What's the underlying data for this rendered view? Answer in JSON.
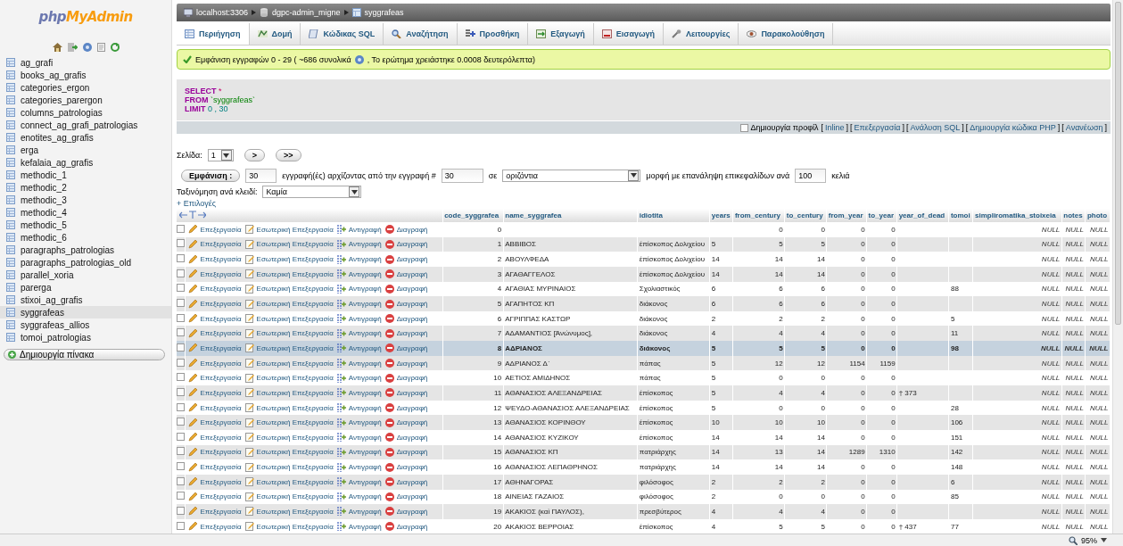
{
  "sidebar": {
    "logo": {
      "first": "php",
      "second": "MyAdmin"
    },
    "tables": [
      {
        "label": "ag_grafi",
        "selected": false
      },
      {
        "label": "books_ag_grafis",
        "selected": false
      },
      {
        "label": "categories_ergon",
        "selected": false
      },
      {
        "label": "categories_parergon",
        "selected": false
      },
      {
        "label": "columns_patrologias",
        "selected": false
      },
      {
        "label": "connect_ag_grafi_patrologias",
        "selected": false
      },
      {
        "label": "enotites_ag_grafis",
        "selected": false
      },
      {
        "label": "erga",
        "selected": false
      },
      {
        "label": "kefalaia_ag_grafis",
        "selected": false
      },
      {
        "label": "methodic_1",
        "selected": false
      },
      {
        "label": "methodic_2",
        "selected": false
      },
      {
        "label": "methodic_3",
        "selected": false
      },
      {
        "label": "methodic_4",
        "selected": false
      },
      {
        "label": "methodic_5",
        "selected": false
      },
      {
        "label": "methodic_6",
        "selected": false
      },
      {
        "label": "paragraphs_patrologias",
        "selected": false
      },
      {
        "label": "paragraphs_patrologias_old",
        "selected": false
      },
      {
        "label": "parallel_xoria",
        "selected": false
      },
      {
        "label": "parerga",
        "selected": false
      },
      {
        "label": "stixoi_ag_grafis",
        "selected": false
      },
      {
        "label": "syggrafeas",
        "selected": true
      },
      {
        "label": "syggrafeas_allios",
        "selected": false
      },
      {
        "label": "tomoi_patrologias",
        "selected": false
      }
    ],
    "create_button": "Δημιουργία πίνακα"
  },
  "breadcrumb": [
    "localhost:3306",
    "dgpc-admin_migne",
    "syggrafeas"
  ],
  "tabs": [
    {
      "label": "Περιήγηση",
      "selected": true
    },
    {
      "label": "Δομή",
      "selected": false
    },
    {
      "label": "Κώδικας SQL",
      "selected": false
    },
    {
      "label": "Αναζήτηση",
      "selected": false
    },
    {
      "label": "Προσθήκη",
      "selected": false
    },
    {
      "label": "Εξαγωγή",
      "selected": false
    },
    {
      "label": "Εισαγωγή",
      "selected": false
    },
    {
      "label": "Λειτουργίες",
      "selected": false
    },
    {
      "label": "Παρακολούθηση",
      "selected": false
    }
  ],
  "message": {
    "text": "Εμφάνιση εγγραφών 0 - 29 ( ~686 συνολικά",
    "after": ", Το ερώτημα χρειάστηκε 0.0008 δευτερόλεπτα)"
  },
  "sql": [
    {
      "keyword": "SELECT",
      "rest": "*",
      "kind": "operator"
    },
    {
      "keyword": "FROM",
      "rest": "`syggrafeas`",
      "kind": "identifier"
    },
    {
      "keyword": "LIMIT",
      "rest": "0 , 30",
      "kind": "number"
    }
  ],
  "query_options": {
    "profiling": {
      "label": "Δημιουργία προφίλ",
      "checked": false
    },
    "links": [
      {
        "before": "[",
        "label": "Inline",
        "after": "]"
      },
      {
        "before": "[",
        "label": "Επεξεργασία",
        "after": "]"
      },
      {
        "before": "[",
        "label": "Ανάλυση SQL",
        "after": "]"
      },
      {
        "before": "[",
        "label": "Δημιουργία κώδικα PHP",
        "after": "]"
      },
      {
        "before": "[",
        "label": "Ανανέωση",
        "after": "]"
      }
    ]
  },
  "pagination": {
    "label": "Σελίδα:",
    "page": "1",
    "buttons": [
      ">",
      ">>"
    ]
  },
  "display": {
    "button": "Εμφάνιση :",
    "rows": "30",
    "text1": "εγγραφή(ές) αρχίζοντας από την εγγραφή #",
    "start": "30",
    "text2": "σε",
    "mode": "οριζόντια",
    "text3": "μορφή με επανάληψη επικεφαλίδων ανά",
    "repeat": "100",
    "text4": "κελιά"
  },
  "sort": {
    "label": "Ταξινόμηση ανά κλειδί:",
    "value": "Καμία"
  },
  "options_link": "+ Επιλογές",
  "table": {
    "columns": [
      "code_syggrafea",
      "name_syggrafea",
      "idiotita",
      "years",
      "from_century",
      "to_century",
      "from_year",
      "to_year",
      "year_of_dead",
      "tomoi",
      "simpliromatika_stoixeia",
      "notes",
      "photo"
    ],
    "rows": [
      {
        "checked": false,
        "selected": false,
        "actions": [
          "Επεξεργασία",
          "Εσωτερική Επεξεργασία",
          "Αντιγραφή",
          "Διαγραφή"
        ],
        "cells": [
          "0",
          null,
          null,
          null,
          "0",
          "0",
          "0",
          "0",
          null,
          null,
          "NULL",
          "NULL",
          "NULL"
        ]
      },
      {
        "checked": false,
        "selected": false,
        "actions": [
          "Επεξεργασία",
          "Εσωτερική Επεξεργασία",
          "Αντιγραφή",
          "Διαγραφή"
        ],
        "cells": [
          "1",
          "ΑΒΒΙΒΟΣ",
          "έπίσκοπος Δολιχείου",
          "5",
          "5",
          "5",
          "0",
          "0",
          null,
          null,
          "NULL",
          "NULL",
          "NULL"
        ]
      },
      {
        "checked": false,
        "selected": false,
        "actions": [
          "Επεξεργασία",
          "Εσωτερική Επεξεργασία",
          "Αντιγραφή",
          "Διαγραφή"
        ],
        "cells": [
          "2",
          "ΑΒΟΥΛΦΕΔΑ",
          "έπίσκοπος Δολιχείου",
          "14",
          "14",
          "14",
          "0",
          "0",
          null,
          null,
          "NULL",
          "NULL",
          "NULL"
        ]
      },
      {
        "checked": false,
        "selected": false,
        "actions": [
          "Επεξεργασία",
          "Εσωτερική Επεξεργασία",
          "Αντιγραφή",
          "Διαγραφή"
        ],
        "cells": [
          "3",
          "ΑΓΑΘΑΓΓΕΛΟΣ",
          "έπίσκοπος Δολιχείου",
          "14",
          "14",
          "14",
          "0",
          "0",
          null,
          null,
          "NULL",
          "NULL",
          "NULL"
        ]
      },
      {
        "checked": false,
        "selected": false,
        "actions": [
          "Επεξεργασία",
          "Εσωτερική Επεξεργασία",
          "Αντιγραφή",
          "Διαγραφή"
        ],
        "cells": [
          "4",
          "ΑΓΑΘΙΑΣ ΜΥΡΙΝΑΙΟΣ",
          "Σχολιαστικός",
          "6",
          "6",
          "6",
          "0",
          "0",
          null,
          "88",
          "NULL",
          "NULL",
          "NULL"
        ]
      },
      {
        "checked": false,
        "selected": false,
        "actions": [
          "Επεξεργασία",
          "Εσωτερική Επεξεργασία",
          "Αντιγραφή",
          "Διαγραφή"
        ],
        "cells": [
          "5",
          "ΑΓΑΠΗΤΟΣ ΚΠ",
          "διάκονος",
          "6",
          "6",
          "6",
          "0",
          "0",
          null,
          null,
          "NULL",
          "NULL",
          "NULL"
        ]
      },
      {
        "checked": false,
        "selected": false,
        "actions": [
          "Επεξεργασία",
          "Εσωτερική Επεξεργασία",
          "Αντιγραφή",
          "Διαγραφή"
        ],
        "cells": [
          "6",
          "ΑΓΡΙΠΠΑΣ ΚΑΣΤΩΡ",
          "διάκονος",
          "2",
          "2",
          "2",
          "0",
          "0",
          null,
          "5",
          "NULL",
          "NULL",
          "NULL"
        ]
      },
      {
        "checked": false,
        "selected": false,
        "actions": [
          "Επεξεργασία",
          "Εσωτερική Επεξεργασία",
          "Αντιγραφή",
          "Διαγραφή"
        ],
        "cells": [
          "7",
          "ΑΔΑΜΑΝΤΙΟΣ [Ἀνώνυμος],",
          "διάκονος",
          "4",
          "4",
          "4",
          "0",
          "0",
          null,
          "11",
          "NULL",
          "NULL",
          "NULL"
        ]
      },
      {
        "checked": false,
        "selected": true,
        "actions": [
          "Επεξεργασία",
          "Εσωτερική Επεξεργασία",
          "Αντιγραφή",
          "Διαγραφή"
        ],
        "cells": [
          "8",
          "ΑΔΡΙΑΝΟΣ",
          "διάκονος",
          "5",
          "5",
          "5",
          "0",
          "0",
          null,
          "98",
          "NULL",
          "NULL",
          "NULL"
        ]
      },
      {
        "checked": false,
        "selected": false,
        "actions": [
          "Επεξεργασία",
          "Εσωτερική Επεξεργασία",
          "Αντιγραφή",
          "Διαγραφή"
        ],
        "cells": [
          "9",
          "ΑΔΡΙΑΝΟΣ Δ΄",
          "πάπας",
          "5",
          "12",
          "12",
          "1154",
          "1159",
          null,
          null,
          "NULL",
          "NULL",
          "NULL"
        ]
      },
      {
        "checked": false,
        "selected": false,
        "actions": [
          "Επεξεργασία",
          "Εσωτερική Επεξεργασία",
          "Αντιγραφή",
          "Διαγραφή"
        ],
        "cells": [
          "10",
          "ΑΕΤΙΟΣ ΑΜΙΔΗΝΟΣ",
          "πάπας",
          "5",
          "0",
          "0",
          "0",
          "0",
          null,
          null,
          "NULL",
          "NULL",
          "NULL"
        ]
      },
      {
        "checked": false,
        "selected": false,
        "actions": [
          "Επεξεργασία",
          "Εσωτερική Επεξεργασία",
          "Αντιγραφή",
          "Διαγραφή"
        ],
        "cells": [
          "11",
          "ΑΘΑΝΑΣΙΟΣ ΑΛΕΞΑΝΔΡΕΙΑΣ",
          "έπίσκοπος",
          "5",
          "4",
          "4",
          "0",
          "0",
          "† 373",
          null,
          "NULL",
          "NULL",
          "NULL"
        ]
      },
      {
        "checked": false,
        "selected": false,
        "actions": [
          "Επεξεργασία",
          "Εσωτερική Επεξεργασία",
          "Αντιγραφή",
          "Διαγραφή"
        ],
        "cells": [
          "12",
          "ΨΕΥΔΟ-ΑΘΑΝΑΣΙΟΣ ΑΛΕΞΑΝΔΡΕΙΑΣ",
          "έπίσκοπος",
          "5",
          "0",
          "0",
          "0",
          "0",
          null,
          "28",
          "NULL",
          "NULL",
          "NULL"
        ]
      },
      {
        "checked": false,
        "selected": false,
        "actions": [
          "Επεξεργασία",
          "Εσωτερική Επεξεργασία",
          "Αντιγραφή",
          "Διαγραφή"
        ],
        "cells": [
          "13",
          "ΑΘΑΝΑΣΙΟΣ ΚΟΡΙΝΘΟΥ",
          "έπίσκοπος",
          "10",
          "10",
          "10",
          "0",
          "0",
          null,
          "106",
          "NULL",
          "NULL",
          "NULL"
        ]
      },
      {
        "checked": false,
        "selected": false,
        "actions": [
          "Επεξεργασία",
          "Εσωτερική Επεξεργασία",
          "Αντιγραφή",
          "Διαγραφή"
        ],
        "cells": [
          "14",
          "ΑΘΑΝΑΣΙΟΣ ΚΥΖΙΚΟΥ",
          "έπίσκοπος",
          "14",
          "14",
          "14",
          "0",
          "0",
          null,
          "151",
          "NULL",
          "NULL",
          "NULL"
        ]
      },
      {
        "checked": false,
        "selected": false,
        "actions": [
          "Επεξεργασία",
          "Εσωτερική Επεξεργασία",
          "Αντιγραφή",
          "Διαγραφή"
        ],
        "cells": [
          "15",
          "ΑΘΑΝΑΣΙΟΣ ΚΠ",
          "πατριάρχης",
          "14",
          "13",
          "14",
          "1289",
          "1310",
          null,
          "142",
          "NULL",
          "NULL",
          "NULL"
        ]
      },
      {
        "checked": false,
        "selected": false,
        "actions": [
          "Επεξεργασία",
          "Εσωτερική Επεξεργασία",
          "Αντιγραφή",
          "Διαγραφή"
        ],
        "cells": [
          "16",
          "ΑΘΑΝΑΣΙΟΣ ΛΕΠΑΘΡΗΝΟΣ",
          "πατριάρχης",
          "14",
          "14",
          "14",
          "0",
          "0",
          null,
          "148",
          "NULL",
          "NULL",
          "NULL"
        ]
      },
      {
        "checked": false,
        "selected": false,
        "actions": [
          "Επεξεργασία",
          "Εσωτερική Επεξεργασία",
          "Αντιγραφή",
          "Διαγραφή"
        ],
        "cells": [
          "17",
          "ΑΘΗΝΑΓΟΡΑΣ",
          "φιλόσοφος",
          "2",
          "2",
          "2",
          "0",
          "0",
          null,
          "6",
          "NULL",
          "NULL",
          "NULL"
        ]
      },
      {
        "checked": false,
        "selected": false,
        "actions": [
          "Επεξεργασία",
          "Εσωτερική Επεξεργασία",
          "Αντιγραφή",
          "Διαγραφή"
        ],
        "cells": [
          "18",
          "ΑΙΝΕΙΑΣ ΓΑΖΑΙΟΣ",
          "φιλόσοφος",
          "2",
          "0",
          "0",
          "0",
          "0",
          null,
          "85",
          "NULL",
          "NULL",
          "NULL"
        ]
      },
      {
        "checked": false,
        "selected": false,
        "actions": [
          "Επεξεργασία",
          "Εσωτερική Επεξεργασία",
          "Αντιγραφή",
          "Διαγραφή"
        ],
        "cells": [
          "19",
          "ΑΚΑΚΙΟΣ (καὶ ΠΑΥΛΟΣ),",
          "πρεσβύτερος",
          "4",
          "4",
          "4",
          "0",
          "0",
          null,
          null,
          "NULL",
          "NULL",
          "NULL"
        ]
      },
      {
        "checked": false,
        "selected": false,
        "actions": [
          "Επεξεργασία",
          "Εσωτερική Επεξεργασία",
          "Αντιγραφή",
          "Διαγραφή"
        ],
        "cells": [
          "20",
          "ΑΚΑΚΙΟΣ ΒΕΡΡΟΙΑΣ",
          "έπίσκοπος",
          "4",
          "5",
          "5",
          "0",
          "0",
          "† 437",
          "77",
          "NULL",
          "NULL",
          "NULL"
        ]
      }
    ]
  },
  "status_bar": {
    "zoom": "95%"
  }
}
